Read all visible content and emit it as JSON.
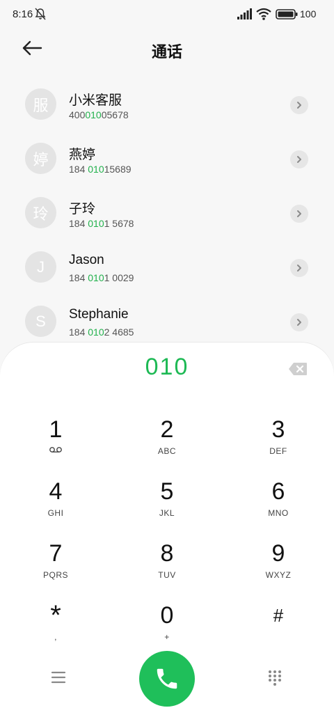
{
  "status_bar": {
    "time": "8:16",
    "battery": "100",
    "icons": [
      "bell-muted-icon",
      "signal-icon",
      "wifi-icon",
      "battery-icon"
    ]
  },
  "header": {
    "title": "通话",
    "back_icon": "arrow-left-icon"
  },
  "contacts": [
    {
      "avatar": "服",
      "name": "小米客服",
      "number_pre": "400",
      "number_match": "010",
      "number_post": "05678"
    },
    {
      "avatar": "婷",
      "name": "燕婷",
      "number_pre": "184 ",
      "number_match": "010",
      "number_post": "15689"
    },
    {
      "avatar": "玲",
      "name": "子玲",
      "number_pre": "184 ",
      "number_match": "010",
      "number_post": "1 5678"
    },
    {
      "avatar": "J",
      "name": "Jason",
      "number_pre": "184 ",
      "number_match": "010",
      "number_post": "1 0029"
    },
    {
      "avatar": "S",
      "name": "Stephanie",
      "number_pre": "184 ",
      "number_match": "010",
      "number_post": "2 4685"
    }
  ],
  "dialer": {
    "input": "010",
    "backspace_icon": "backspace-icon",
    "keys": [
      {
        "digit": "1",
        "letters": ""
      },
      {
        "digit": "2",
        "letters": "ABC"
      },
      {
        "digit": "3",
        "letters": "DEF"
      },
      {
        "digit": "4",
        "letters": "GHI"
      },
      {
        "digit": "5",
        "letters": "JKL"
      },
      {
        "digit": "6",
        "letters": "MNO"
      },
      {
        "digit": "7",
        "letters": "PQRS"
      },
      {
        "digit": "8",
        "letters": "TUV"
      },
      {
        "digit": "9",
        "letters": "WXYZ"
      },
      {
        "digit": "*",
        "letters": ","
      },
      {
        "digit": "0",
        "letters": "+"
      },
      {
        "digit": "#",
        "letters": ""
      }
    ]
  },
  "colors": {
    "accent": "#1db954",
    "call_button": "#1fbf5a",
    "avatar_bg": "#e4e4e4"
  }
}
